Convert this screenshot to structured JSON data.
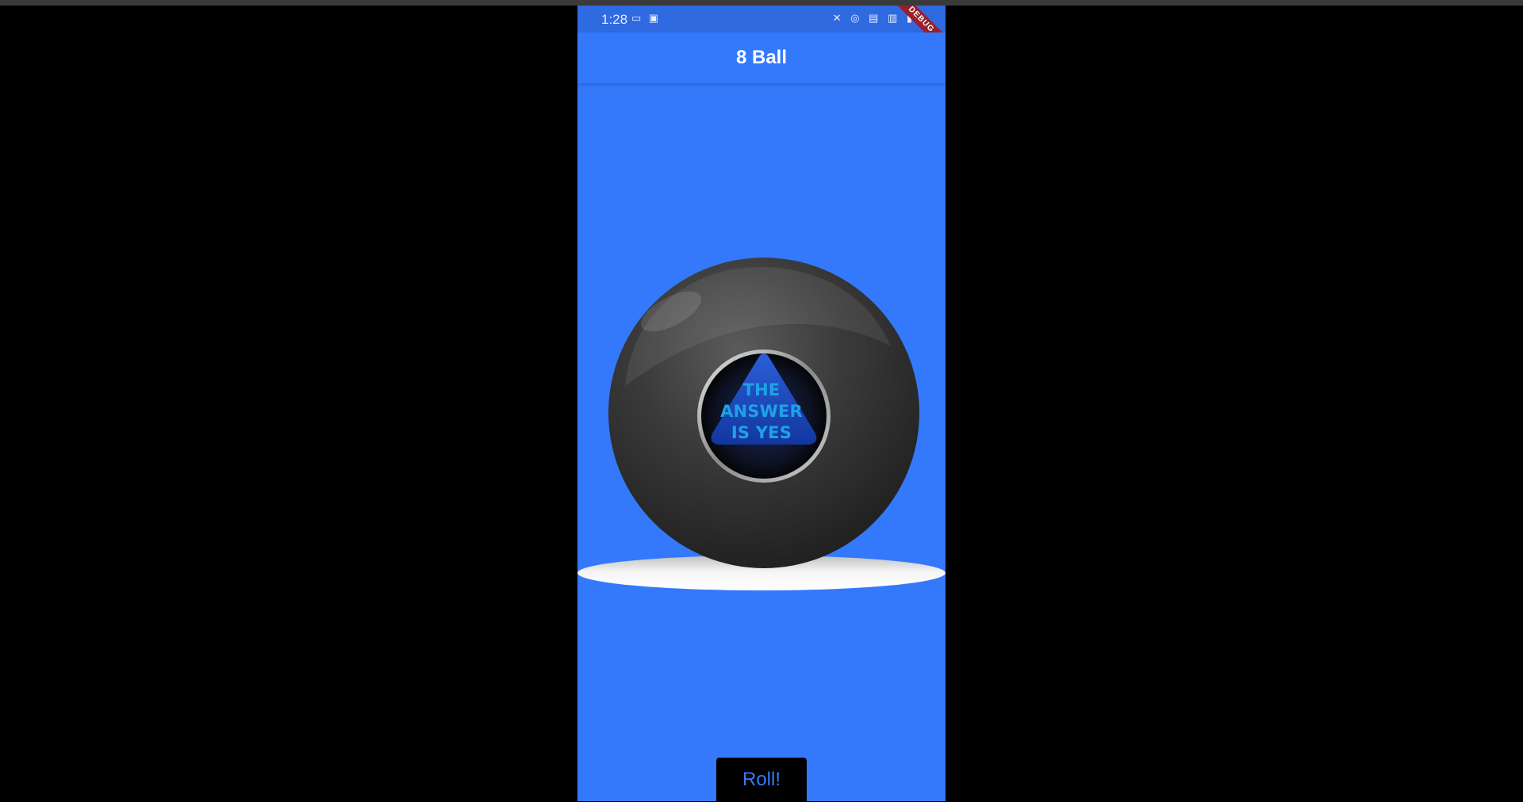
{
  "status_bar": {
    "time": "1:28",
    "left_icons": [
      "voicemail-icon",
      "checklist-icon"
    ],
    "right_icons": [
      "mute-icon",
      "hotspot-icon",
      "volte-icon",
      "signal-4g-icon",
      "signal-bars-icon"
    ],
    "left_icons_glyph": "▭ ▣",
    "right_icons_glyph": "✕ ◎ ▤ ▥ ▮"
  },
  "debug_banner": "DEBUG",
  "app_bar": {
    "title": "8 Ball"
  },
  "ball": {
    "answer_lines": [
      "THE",
      "ANSWER",
      "IS YES"
    ]
  },
  "roll_button": {
    "label": "Roll!"
  },
  "colors": {
    "background": "#3479fb",
    "status_bar": "#2f6ae0",
    "answer_text": "#1ea2e6",
    "button_bg": "#000000",
    "button_text": "#3479fb"
  }
}
